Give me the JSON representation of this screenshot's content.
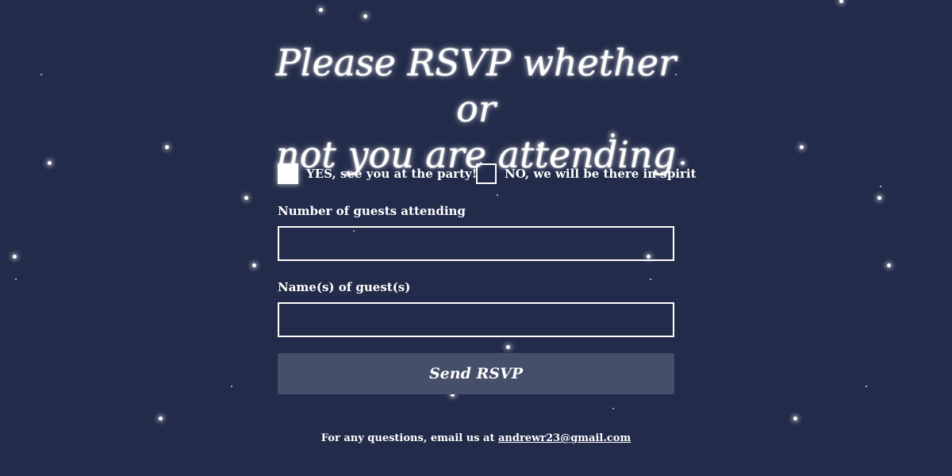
{
  "page": {
    "background_color": "#222b49",
    "accent_color": "#ffffff",
    "button_color": "#464f6a"
  },
  "heading": {
    "line1": "Please RSVP whether or",
    "line2": "not you are attending"
  },
  "options": {
    "yes": {
      "label": "YES, see you at the party!",
      "checked": true
    },
    "no": {
      "label": "NO, we will be there in spirit",
      "checked": false
    }
  },
  "form": {
    "guests_label": "Number of guests attending",
    "guests_value": "",
    "names_label": "Name(s) of guest(s)",
    "names_value": "",
    "submit_label": "Send RSVP"
  },
  "footer": {
    "text": "For any questions, email us at ",
    "email": "andrewr23@gmail.com"
  }
}
